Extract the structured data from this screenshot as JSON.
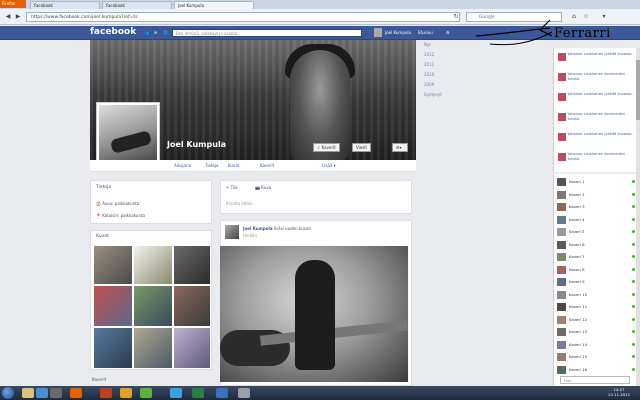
{
  "browser": {
    "app_button": "Firefox",
    "tabs": [
      {
        "label": "Facebook"
      },
      {
        "label": "Facebook"
      },
      {
        "label": "Joel Kumpula"
      }
    ],
    "url": "https://www.facebook.com/joel.kumpula?ref=ts",
    "search_placeholder": "Google"
  },
  "facebook": {
    "logo": "facebook",
    "search_placeholder": "Etsi ihmisiä, paikkoja ja asioita",
    "user_name": "Joel Kumpula",
    "home_label": "Etusivu"
  },
  "profile": {
    "name": "Joel Kumpula",
    "buttons": {
      "friends": "✓ Kaverit",
      "message": "Viesti"
    },
    "tabs": [
      "Aikajana",
      "Tietoja",
      "Kuvat",
      "Kaverit",
      "Lisää ▾"
    ],
    "years": [
      "Nyt",
      "2012",
      "2011",
      "2010",
      "2009",
      "Syntynyt"
    ]
  },
  "about": {
    "title": "Tietoja",
    "lines": [
      "Asuu: paikkakunta",
      "Kotoisin: paikkakunta"
    ]
  },
  "photos": {
    "title": "Kuvat"
  },
  "composer": {
    "tabs": [
      "Tila",
      "Kuva"
    ],
    "placeholder": "Kirjoita jotain..."
  },
  "post": {
    "author": "Joel Kumpula",
    "action": "lisäsi uuden kuvan",
    "time": "tänään",
    "bottom_label": "Kaverit"
  },
  "annotation": {
    "text": "Ferrarri"
  },
  "ticker": {
    "items": [
      {
        "text": "Johanna Laukkanen tykkää kuvasta."
      },
      {
        "text": "Johanna Laukkanen kommentoi kuvaa."
      },
      {
        "text": "Johanna Laukkanen tykkää kuvasta."
      },
      {
        "text": "Johanna Laukkanen kommentoi kuvaa."
      },
      {
        "text": "Johanna Laukkanen tykkää kuvasta."
      },
      {
        "text": "Johanna Laukkanen kommentoi kuvaa."
      }
    ]
  },
  "chat": {
    "friends": [
      "Kaveri 1",
      "Kaveri 2",
      "Kaveri 3",
      "Kaveri 4",
      "Kaveri 5",
      "Kaveri 6",
      "Kaveri 7",
      "Kaveri 8",
      "Kaveri 9",
      "Kaveri 10",
      "Kaveri 11",
      "Kaveri 12",
      "Kaveri 13",
      "Kaveri 14",
      "Kaveri 15",
      "Kaveri 16"
    ],
    "search_placeholder": "Hae"
  },
  "taskbar": {
    "time": "14:27",
    "date": "23.11.2012"
  },
  "colors": {
    "fb_blue": "#3b5998",
    "online_green": "#42b72a",
    "firefox_orange": "#e66000"
  }
}
